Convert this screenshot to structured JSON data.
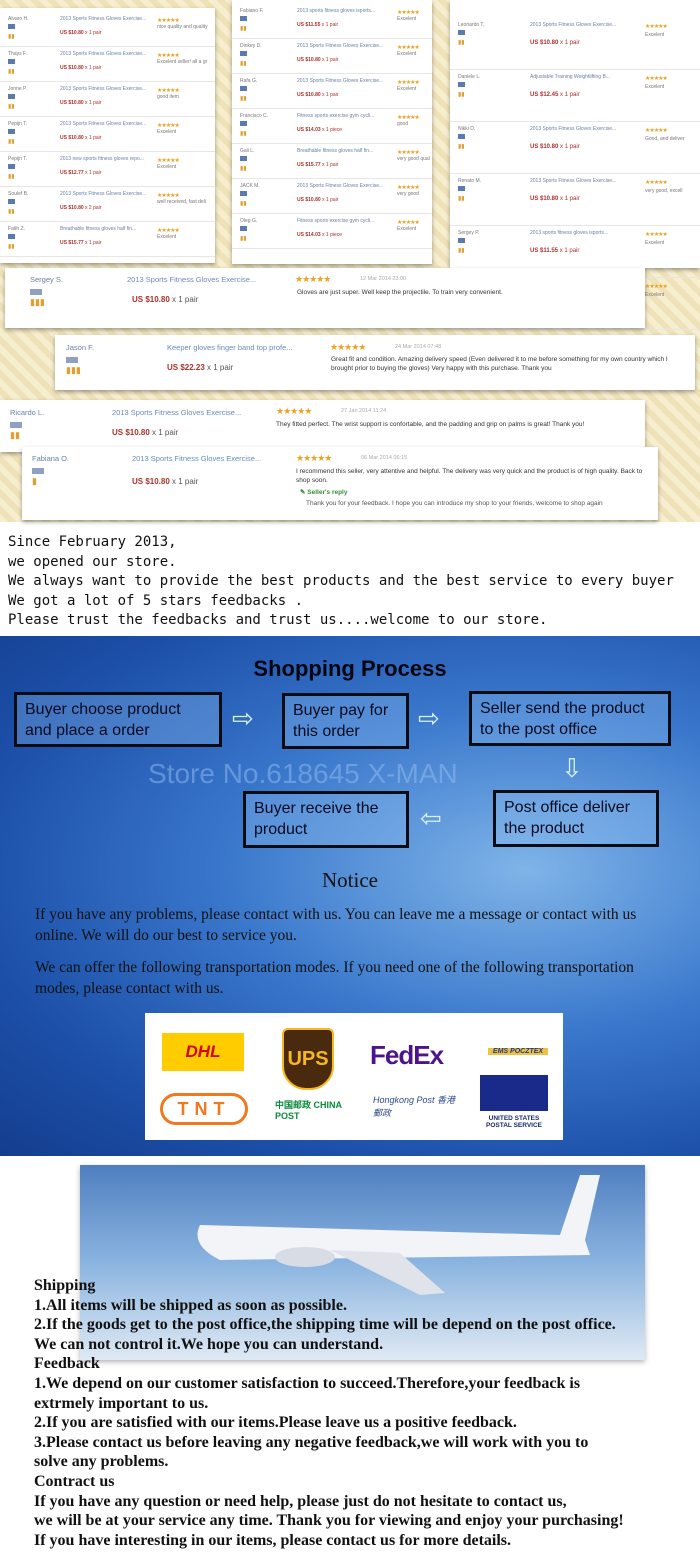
{
  "feedback_columns": [
    [
      {
        "name": "Alvaro H.",
        "product": "2013 Sports Fitness Gloves Exercise...",
        "price": "US $10.80",
        "qty": "x 1 pair",
        "comment": "nice quality and quality"
      },
      {
        "name": "Thays F.",
        "product": "2013 Sports Fitness Gloves Exercise...",
        "price": "US $10.80",
        "qty": "x 1 pair",
        "comment": "Excelent seller! all a gr"
      },
      {
        "name": "Jonne P.",
        "product": "2013 Sports Fitness Gloves Exercise...",
        "price": "US $10.80",
        "qty": "x 1 pair",
        "comment": "good item"
      },
      {
        "name": "Pepijn T.",
        "product": "2013 Sports Fitness Gloves Exercise...",
        "price": "US $10.80",
        "qty": "x 1 pair",
        "comment": "Excelent"
      },
      {
        "name": "Pepijn T.",
        "product": "2013 new sports fitness gloves repo...",
        "price": "US $12.77",
        "qty": "x 1 pair",
        "comment": "Excelent"
      },
      {
        "name": "Soulef B.",
        "product": "2013 Sports Fitness Gloves Exercise...",
        "price": "US $10.80",
        "qty": "x 2 pair",
        "comment": "well received, fast deli"
      },
      {
        "name": "Fatih Z.",
        "product": "Breathable fitness gloves half fin...",
        "price": "US $15.77",
        "qty": "x 1 pair",
        "comment": "Excelent"
      }
    ],
    [
      {
        "name": "Fabiano F.",
        "product": "2013 sports fitness gloves isports...",
        "price": "US $11.55",
        "qty": "x 1 pair",
        "comment": "Excelent"
      },
      {
        "name": "Dinkey D.",
        "product": "2013 Sports Fitness Gloves Exercise...",
        "price": "US $10.80",
        "qty": "x 1 pair",
        "comment": "Excelent"
      },
      {
        "name": "Rafa G.",
        "product": "2013 Sports Fitness Gloves Exercise...",
        "price": "US $10.80",
        "qty": "x 1 pair",
        "comment": "Excelent"
      },
      {
        "name": "Francisco C.",
        "product": "Fitness sports exercise gym cycli...",
        "price": "US $14.03",
        "qty": "x 1 piece",
        "comment": "good"
      },
      {
        "name": "Gali L.",
        "product": "Breathable fitness gloves half fin...",
        "price": "US $15.77",
        "qty": "x 1 pair",
        "comment": "very good qual"
      },
      {
        "name": "JACK M.",
        "product": "2013 Sports Fitness Gloves Exercise...",
        "price": "US $10.80",
        "qty": "x 1 pair",
        "comment": "very good"
      },
      {
        "name": "Oleg G.",
        "product": "Fitness sports exercise gym cycli...",
        "price": "US $14.03",
        "qty": "x 1 piece",
        "comment": "Excelent"
      }
    ],
    [
      {
        "name": "Leonardo T.",
        "product": "2013 Sports Fitness Gloves Exercise...",
        "price": "US $10.80",
        "qty": "x 1 pair",
        "comment": "Excelent"
      },
      {
        "name": "Daniele L.",
        "product": "Adjustable Training Weightlifting B...",
        "price": "US $12.45",
        "qty": "x 1 pair",
        "comment": "Excelent"
      },
      {
        "name": "Nikki D.",
        "product": "2013 Sports Fitness Gloves Exercise...",
        "price": "US $10.80",
        "qty": "x 1 pair",
        "comment": "Good, and deliver"
      },
      {
        "name": "Renato M.",
        "product": "2013 Sports Fitness Gloves Exercise...",
        "price": "US $10.80",
        "qty": "x 1 pair",
        "comment": "very good, excell"
      },
      {
        "name": "Sergey P.",
        "product": "2013 sports fitness gloves isports...",
        "price": "US $11.55",
        "qty": "x 1 pair",
        "comment": "Excelent"
      },
      {
        "name": "Renato R.",
        "product": "free shipping brand new black golf...",
        "price": "US $13.00",
        "qty": "x 1 Lot",
        "comment": "Excelent"
      }
    ]
  ],
  "stars": "★★★★★",
  "big_reviews": [
    {
      "name": "Sergey S.",
      "product": "2013 Sports Fitness Gloves Exercise...",
      "price": "US $10.80",
      "qty": " x 1 pair",
      "date": "12 Mar 2014 23:00",
      "comment": "Gloves are just super. Well keep the projectile. To train very convenient.",
      "medals": "▮▮▮"
    },
    {
      "name": "Jason F.",
      "product": "Keeper gloves finger band top profe...",
      "price": "US $22.23",
      "qty": " x 1 pair",
      "date": "24 Mar 2014 07:48",
      "comment": "Great fit and condition. Amazing delivery speed (Even delivered it to me before something for my own country which I brought prior to buying the gloves) Very happy with this purchase. Thank you",
      "medals": "▮▮▮"
    },
    {
      "name": "Ricardo L.",
      "product": "2013 Sports Fitness Gloves Exercise...",
      "price": "US $10.80",
      "qty": " x 1 pair",
      "date": "27 Jan 2014 11:24",
      "comment": "They fitted perfect. The wrist support is confortable, and the padding and grip on palms is great! Thank you!",
      "medals": "▮▮"
    },
    {
      "name": "Fabiana O.",
      "product": "2013 Sports Fitness Gloves Exercise...",
      "price": "US $10.80",
      "qty": " x 1 pair",
      "date": "06 Mar 2014 06:15",
      "comment": "I recommend this seller, very attentive and helpful. The delivery was very quick and the product is of high quality. Back to shop soon.",
      "medals": "▮",
      "reply_label": "Seller's reply",
      "reply": "Thank you for your feedback. I hope you can introduce my shop to your friends, welcome to shop again"
    }
  ],
  "intro": "Since February 2013,\nwe opened our store.\nWe always want to provide the best products and the best service to every buyer\nWe got a lot of 5 stars feedbacks .\nPlease trust the feedbacks and trust us....welcome to our store.",
  "process": {
    "title": "Shopping Process",
    "steps": [
      "Buyer choose product and place a order",
      "Buyer pay for this order",
      "Seller send the product to the post office",
      "Post office deliver the product",
      "Buyer receive the product"
    ],
    "watermark": "Store No.618645 X-MAN",
    "notice_title": "Notice",
    "notice_1": "If you have any problems, please contact with us. You can leave me a message or contact with us online. We will do our best to service you.",
    "notice_2": "We can offer the following transportation modes. If you need one of the following transportation modes, please contact with us."
  },
  "carriers": [
    "DHL",
    "UPS",
    "FedEx",
    "EMS POCZTEX",
    "TNT",
    "中国邮政 CHINA POST",
    "Hongkong Post 香港郵政",
    "UNITED STATES POSTAL SERVICE"
  ],
  "policy": "Shipping\n1.All items will be shipped as soon as possible.\n2.If the goods get to the post office,the shipping time will be depend on the post office.\nWe can not control it.We hope you can understand.\nFeedback\n1.We depend on our customer satisfaction to succeed.Therefore,your feedback is\nextrmely important to us.\n2.If you are satisfied with our items.Please leave us a positive feedback.\n3.Please contact us before leaving any negative feedback,we will work with you to\nsolve any problems.\nContract us\nIf you have any question or need help, please just do not hesitate to contact us,\nwe will be at your service any time. Thank you for viewing and enjoy your purchasing!\nIf you have interesting in our items, please contact us for more details.",
  "colors": {
    "price": "#b0302a",
    "star": "#f0a020",
    "link": "#6a7fa8"
  }
}
